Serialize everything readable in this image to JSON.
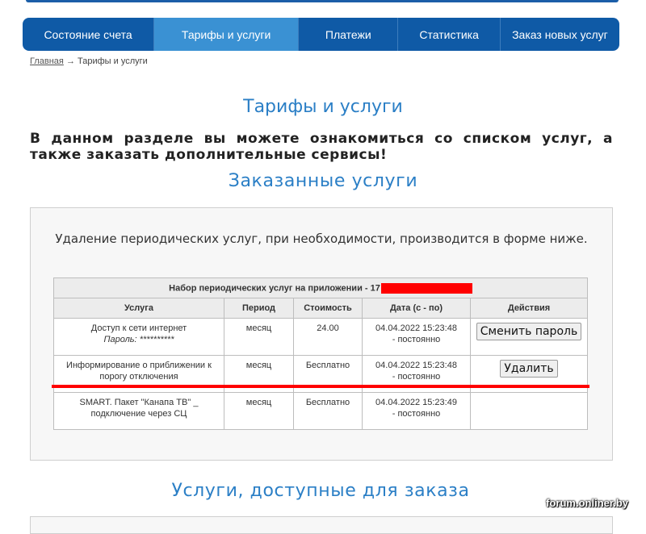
{
  "nav": {
    "items": [
      {
        "label": "Состояние счета",
        "active": false
      },
      {
        "label": "Тарифы и услуги",
        "active": true
      },
      {
        "label": "Платежи",
        "active": false
      },
      {
        "label": "Статистика",
        "active": false
      },
      {
        "label": "Заказ новых услуг",
        "active": false
      }
    ]
  },
  "breadcrumb": {
    "home": "Главная",
    "separator": "→",
    "current": "Тарифы и услуги"
  },
  "page": {
    "title": "Тарифы и услуги",
    "intro": "В данном разделе вы можете ознакомиться со списком услуг, а также заказать дополнительные сервисы!",
    "ordered_title": "Заказанные услуги",
    "available_title": "Услуги, доступные для заказа"
  },
  "panel": {
    "note": "Удаление периодических услуг, при необходимости, производится в форме ниже."
  },
  "table": {
    "caption": "Набор периодических услуг на приложении - 17",
    "headers": [
      "Услуга",
      "Период",
      "Стоимость",
      "Дата (с - по)",
      "Действия"
    ],
    "rows": [
      {
        "service": "Доступ к сети интернет",
        "password_label": "Пароль:",
        "password_value": "**********",
        "period": "месяц",
        "cost": "24.00",
        "date_from": "04.04.2022 15:23:48",
        "date_to": "- постоянно",
        "action": "Сменить пароль"
      },
      {
        "service": "Информирование о приближении к порогу отключения",
        "period": "месяц",
        "cost": "Бесплатно",
        "date_from": "04.04.2022 15:23:48",
        "date_to": "- постоянно",
        "action": "Удалить"
      },
      {
        "service": "SMART. Пакет \"Канапа ТВ\" _ подключение через СЦ",
        "period": "месяц",
        "cost": "Бесплатно",
        "date_from": "04.04.2022 15:23:49",
        "date_to": "- постоянно",
        "action": ""
      }
    ]
  },
  "watermark": "forum.onliner.by",
  "colors": {
    "nav_bg": "#0f5aa6",
    "nav_active": "#3a91d3",
    "heading": "#2b7fc6",
    "redaction": "#ff0000"
  }
}
